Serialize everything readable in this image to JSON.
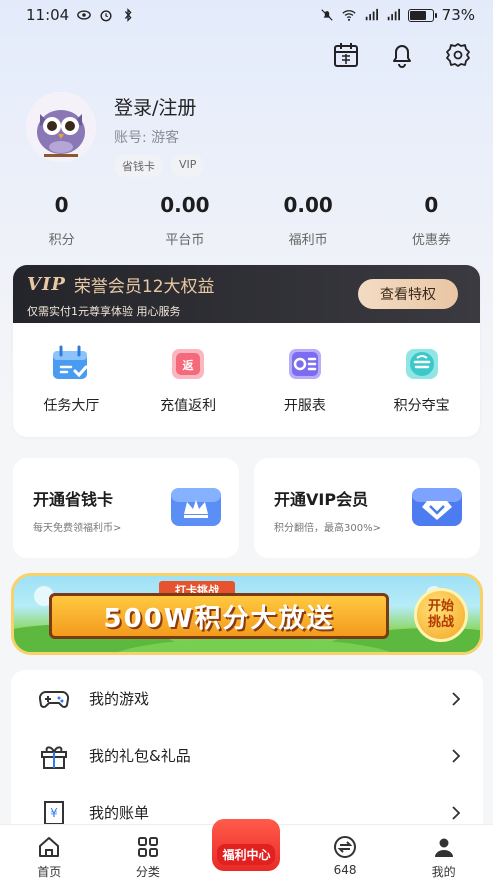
{
  "status_bar": {
    "time": "11:04",
    "battery": "73%",
    "battery_level": 0.73
  },
  "profile": {
    "login_text": "登录/注册",
    "account_label": "账号:",
    "account_value": "游客",
    "tags": [
      "省钱卡",
      "VIP"
    ]
  },
  "stats": [
    {
      "value": "0",
      "label": "积分"
    },
    {
      "value": "0.00",
      "label": "平台币"
    },
    {
      "value": "0.00",
      "label": "福利币"
    },
    {
      "value": "0",
      "label": "优惠券"
    }
  ],
  "vip": {
    "logo": "VIP",
    "title": "荣誉会员12大权益",
    "subtitle": "仅需实付1元尊享体验  用心服务",
    "button": "查看特权"
  },
  "features": [
    {
      "label": "任务大厅",
      "icon": "task-calendar-icon",
      "color": "#4a9cf0"
    },
    {
      "label": "充值返利",
      "icon": "rebate-icon",
      "color": "#f46a7a"
    },
    {
      "label": "开服表",
      "icon": "server-list-icon",
      "color": "#7d6cf2"
    },
    {
      "label": "积分夺宝",
      "icon": "treasure-icon",
      "color": "#3cc7c9"
    }
  ],
  "promos": [
    {
      "title": "开通省钱卡",
      "subtitle": "每天免费领福利币>",
      "icon": "crown-card-icon"
    },
    {
      "title": "开通VIP会员",
      "subtitle": "积分翻倍，最高300%>",
      "icon": "diamond-card-icon"
    }
  ],
  "event_banner": {
    "tag": "打卡挑战",
    "title": "500W积分大放送",
    "button": "开始挑战"
  },
  "menu": [
    {
      "label": "我的游戏",
      "icon": "gamepad-icon"
    },
    {
      "label": "我的礼包&礼品",
      "icon": "gift-icon"
    },
    {
      "label": "我的账单",
      "icon": "bill-icon"
    }
  ],
  "bottom_nav": [
    {
      "label": "首页",
      "icon": "home-icon"
    },
    {
      "label": "分类",
      "icon": "category-icon"
    },
    {
      "label": "福利中心",
      "icon": "welfare-icon"
    },
    {
      "label": "648",
      "icon": "exchange-icon"
    },
    {
      "label": "我的",
      "icon": "user-icon"
    }
  ],
  "colors": {
    "accent": "#2f7bf5",
    "vip_gold": "#e9c9a3",
    "banner_red": "#e92a26"
  }
}
